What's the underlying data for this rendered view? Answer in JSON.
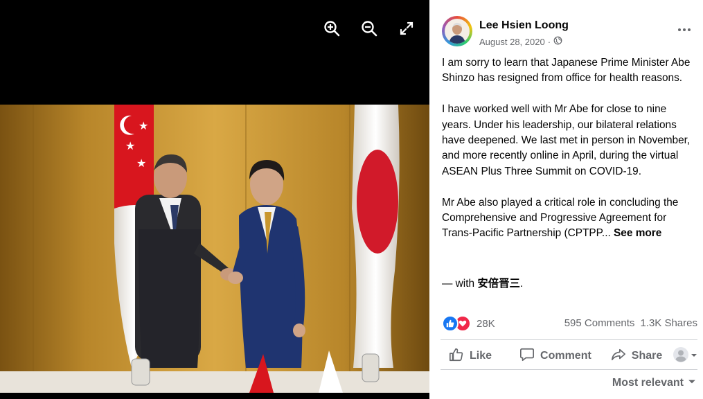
{
  "viewer": {
    "controls": [
      "zoom-in",
      "zoom-out",
      "fullscreen"
    ]
  },
  "post": {
    "author": "Lee Hsien Loong",
    "date": "August 28, 2020",
    "date_separator": "·",
    "audience_icon": "globe-icon",
    "paragraphs": [
      "I am sorry to learn that Japanese Prime Minister Abe Shinzo has resigned from office for health reasons.",
      "I have worked well with Mr Abe for close to nine years. Under his leadership, our bilateral relations have deepened. We last met in person in November, and more recently online in April, during the virtual ASEAN Plus Three Summit on COVID-19.",
      "Mr Abe also played a critical role in concluding the Comprehensive and Progressive Agreement for Trans-Pacific Partnership (CPTPP..."
    ],
    "see_more": "See more",
    "with_prefix": "— with",
    "tagged": "安倍晋三",
    "with_suffix": "."
  },
  "engagement": {
    "reactions": [
      "like",
      "love"
    ],
    "reaction_count": "28K",
    "comments": "595 Comments",
    "shares": "1.3K Shares"
  },
  "actions": {
    "like": "Like",
    "comment": "Comment",
    "share": "Share"
  },
  "comments_sort": "Most relevant",
  "colors": {
    "like_blue": "#1877f2",
    "love_red": "#f02849",
    "muted_text": "#65676b"
  }
}
